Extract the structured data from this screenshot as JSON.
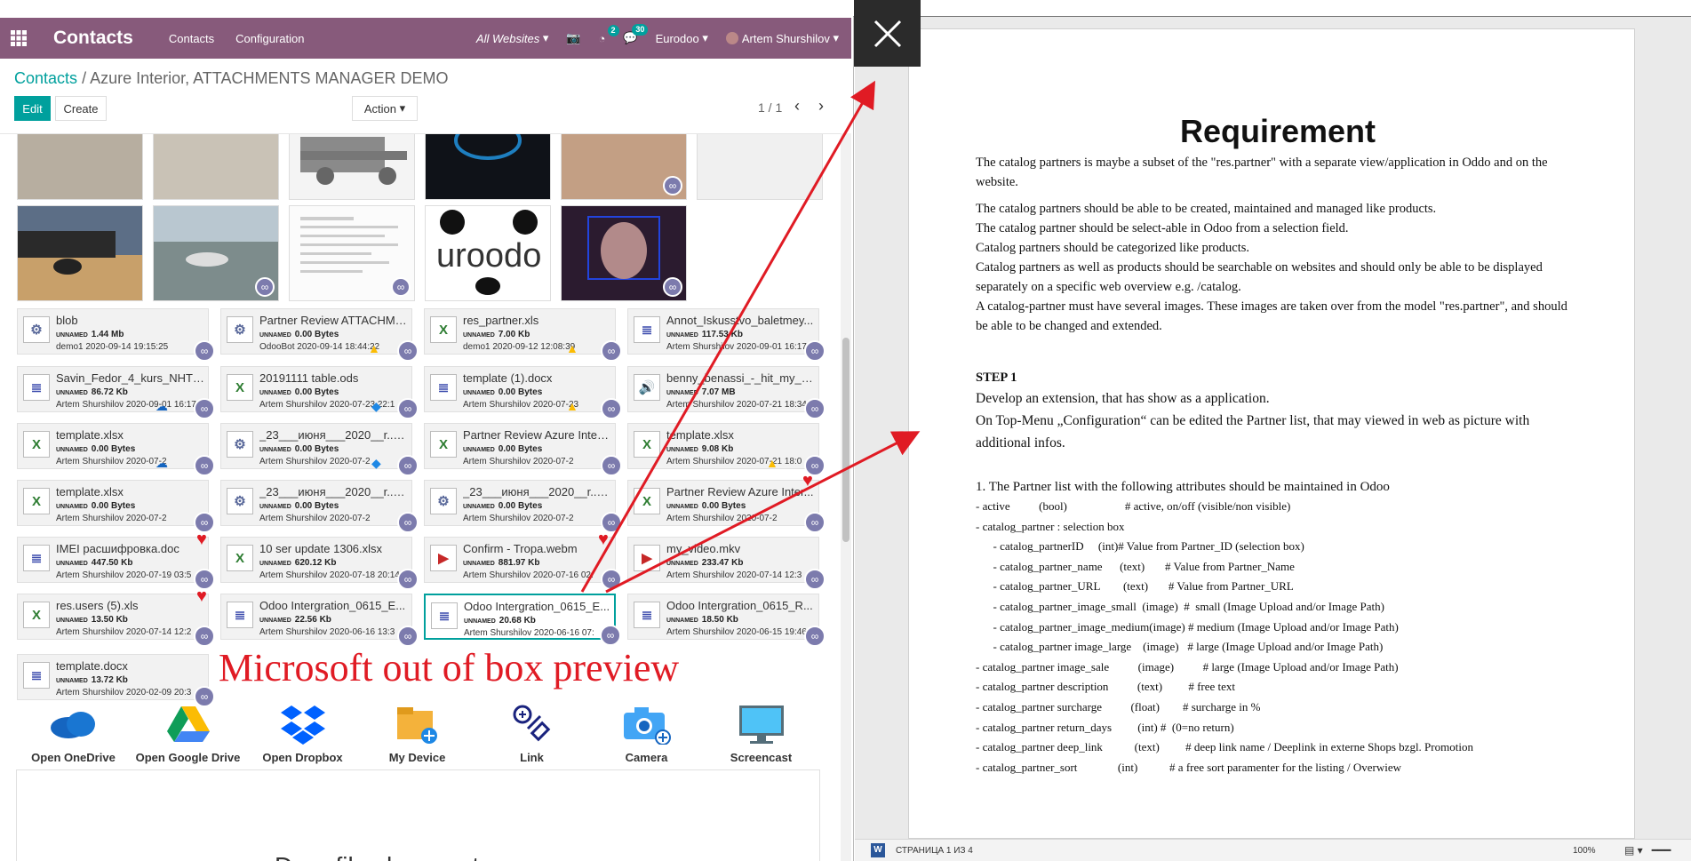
{
  "navbar": {
    "brand": "Contacts",
    "menu": [
      "Contacts",
      "Configuration"
    ],
    "website": "All Websites",
    "activity_count": "2",
    "message_count": "30",
    "company": "Eurodoo",
    "user": "Artem Shurshilov"
  },
  "breadcrumb": {
    "root": "Contacts",
    "current": "Azure Interior, ATTACHMENTS MANAGER DEMO"
  },
  "buttons": {
    "edit": "Edit",
    "create": "Create",
    "action": "Action"
  },
  "pager": {
    "value": "1 / 1"
  },
  "files": [
    {
      "name": "blob",
      "size": "1.44 Mb",
      "meta": "demo1 2020-09-14 19:15:25",
      "icon": "gear"
    },
    {
      "name": "Partner Review ATTACHME...",
      "size": "0.00 Bytes",
      "meta": "OdooBot 2020-09-14 18:44:22",
      "icon": "gear"
    },
    {
      "name": "res_partner.xls",
      "size": "7.00 Kb",
      "meta": "demo1 2020-09-12 12:08:39",
      "icon": "xls"
    },
    {
      "name": "Annot_Iskusstvo_baletmey...",
      "size": "117.53 Kb",
      "meta": "Artem Shurshilov 2020-09-01 16:17",
      "icon": "doc"
    },
    {
      "name": "Savin_Fedor_4_kurs_NHT_...",
      "size": "86.72 Kb",
      "meta": "Artem Shurshilov 2020-09-01 16:17",
      "icon": "doc"
    },
    {
      "name": "20191111 table.ods",
      "size": "0.00 Bytes",
      "meta": "Artem Shurshilov 2020-07-23 22:1",
      "icon": "xls"
    },
    {
      "name": "template (1).docx",
      "size": "0.00 Bytes",
      "meta": "Artem Shurshilov 2020-07-23",
      "icon": "doc"
    },
    {
      "name": "benny_benassi_-_hit_my_h...",
      "size": "7.07 MB",
      "meta": "Artem Shurshilov 2020-07-21 18:34:5",
      "icon": "audio"
    },
    {
      "name": "template.xlsx",
      "size": "0.00 Bytes",
      "meta": "Artem Shurshilov 2020-07-2",
      "icon": "xls"
    },
    {
      "name": "_23___июня___2020__r..png",
      "size": "0.00 Bytes",
      "meta": "Artem Shurshilov 2020-07-2",
      "icon": "gear"
    },
    {
      "name": "Partner Review Azure Interi...",
      "size": "0.00 Bytes",
      "meta": "Artem Shurshilov 2020-07-2",
      "icon": "xls"
    },
    {
      "name": "template.xlsx",
      "size": "9.08 Kb",
      "meta": "Artem Shurshilov 2020-07-21 18:0",
      "icon": "xls"
    },
    {
      "name": "template.xlsx",
      "size": "0.00 Bytes",
      "meta": "Artem Shurshilov 2020-07-2",
      "icon": "xls"
    },
    {
      "name": "_23___июня___2020__r..png",
      "size": "0.00 Bytes",
      "meta": "Artem Shurshilov 2020-07-2",
      "icon": "gear"
    },
    {
      "name": "_23___июня___2020__r..png",
      "size": "0.00 Bytes",
      "meta": "Artem Shurshilov 2020-07-2",
      "icon": "gear"
    },
    {
      "name": "Partner Review Azure Inter...",
      "size": "0.00 Bytes",
      "meta": "Artem Shurshilov 2020-07-2",
      "icon": "xls"
    },
    {
      "name": "IMEI расшифровка.doc",
      "size": "447.50 Kb",
      "meta": "Artem Shurshilov 2020-07-19 03:5",
      "icon": "doc"
    },
    {
      "name": "10 ser update 1306.xlsx",
      "size": "620.12 Kb",
      "meta": "Artem Shurshilov 2020-07-18 20:14:3",
      "icon": "xls"
    },
    {
      "name": "Confirm - Tropa.webm",
      "size": "881.97 Kb",
      "meta": "Artem Shurshilov 2020-07-16 02:",
      "icon": "video"
    },
    {
      "name": "my_video.mkv",
      "size": "233.47 Kb",
      "meta": "Artem Shurshilov 2020-07-14 12:3",
      "icon": "video"
    },
    {
      "name": "res.users (5).xls",
      "size": "13.50 Kb",
      "meta": "Artem Shurshilov 2020-07-14 12:2",
      "icon": "xls"
    },
    {
      "name": "Odoo Intergration_0615_E...",
      "size": "22.56 Kb",
      "meta": "Artem Shurshilov 2020-06-16 13:3",
      "icon": "doc"
    },
    {
      "name": "Odoo Intergration_0615_E...",
      "size": "20.68 Kb",
      "meta": "Artem Shurshilov 2020-06-16 07:",
      "icon": "doc"
    },
    {
      "name": "Odoo Intergration_0615_R...",
      "size": "18.50 Kb",
      "meta": "Artem Shurshilov 2020-06-15 19:46:0",
      "icon": "doc"
    },
    {
      "name": "template.docx",
      "size": "13.72 Kb",
      "meta": "Artem Shurshilov 2020-02-09 20:3",
      "icon": "doc"
    }
  ],
  "unnamed_label": "UNNAMED",
  "annotation": "Microsoft out of box preview",
  "actions": [
    {
      "label": "Open OneDrive",
      "icon": "onedrive-icon"
    },
    {
      "label": "Open Google Drive",
      "icon": "google-drive-icon"
    },
    {
      "label": "Open Dropbox",
      "icon": "dropbox-icon"
    },
    {
      "label": "My Device",
      "icon": "folder-upload-icon"
    },
    {
      "label": "Link",
      "icon": "link-icon"
    },
    {
      "label": "Camera",
      "icon": "camera-icon"
    },
    {
      "label": "Screencast",
      "icon": "monitor-icon"
    }
  ],
  "dropzone_text": "Drop files here or to",
  "document": {
    "title": "Requirement",
    "intro": "The catalog partners is maybe a subset of the \"res.partner\" with a separate view/application in Oddo and on the website.",
    "paras": [
      "The catalog partners should be able to be created, maintained and managed like products.",
      "The catalog partner should be select-able in Odoo from a selection field.",
      "Catalog partners should be categorized like products.",
      "Catalog partners as well as products should be searchable on websites and should only be able to be displayed separately on a specific web overview e.g. /catalog.",
      "A catalog-partner must have several images. These images are taken over from the model \"res.partner\", and should be able to be changed and extended."
    ],
    "step": "STEP 1",
    "step_lines": [
      "Develop an extension, that has show as a application.",
      "On Top-Menu „Configuration“ can be edited the Partner list, that may viewed in web as picture with additional infos."
    ],
    "list_title": "1. The Partner list with the following attributes should be maintained in Odoo",
    "attributes": [
      "- active          (bool)                    # active, on/off (visible/non visible)",
      "- catalog_partner : selection box",
      "      - catalog_partnerID     (int)# Value from Partner_ID (selection box)",
      "      - catalog_partner_name      (text)       # Value from Partner_Name",
      "      - catalog_partner_URL        (text)       # Value from Partner_URL",
      "      - catalog_partner_image_small  (image)  #  small (Image Upload and/or Image Path)",
      "      - catalog_partner_image_medium(image) # medium (Image Upload and/or Image Path)",
      "      - catalog_partner image_large    (image)   # large (Image Upload and/or Image Path)",
      "- catalog_partner image_sale          (image)          # large (Image Upload and/or Image Path)",
      "- catalog_partner description          (text)         # free text",
      "- catalog_partner surcharge          (float)        # surcharge in %",
      "- catalog_partner return_days         (int) #  (0=no return)",
      "- catalog_partner deep_link           (text)         # deep link name / Deeplink in externe Shops bzgl. Promotion",
      "- catalog_partner_sort              (int)           # a free sort paramenter for the listing / Overwiew"
    ]
  },
  "statusbar": {
    "page": "СТРАНИЦА 1 ИЗ 4",
    "zoom": "100%",
    "word_icon": "W"
  },
  "colors": {
    "navbar": "#875a7b",
    "accent": "#00a09d",
    "annotation": "#e01b24",
    "link_badge": "#7c7bad"
  }
}
